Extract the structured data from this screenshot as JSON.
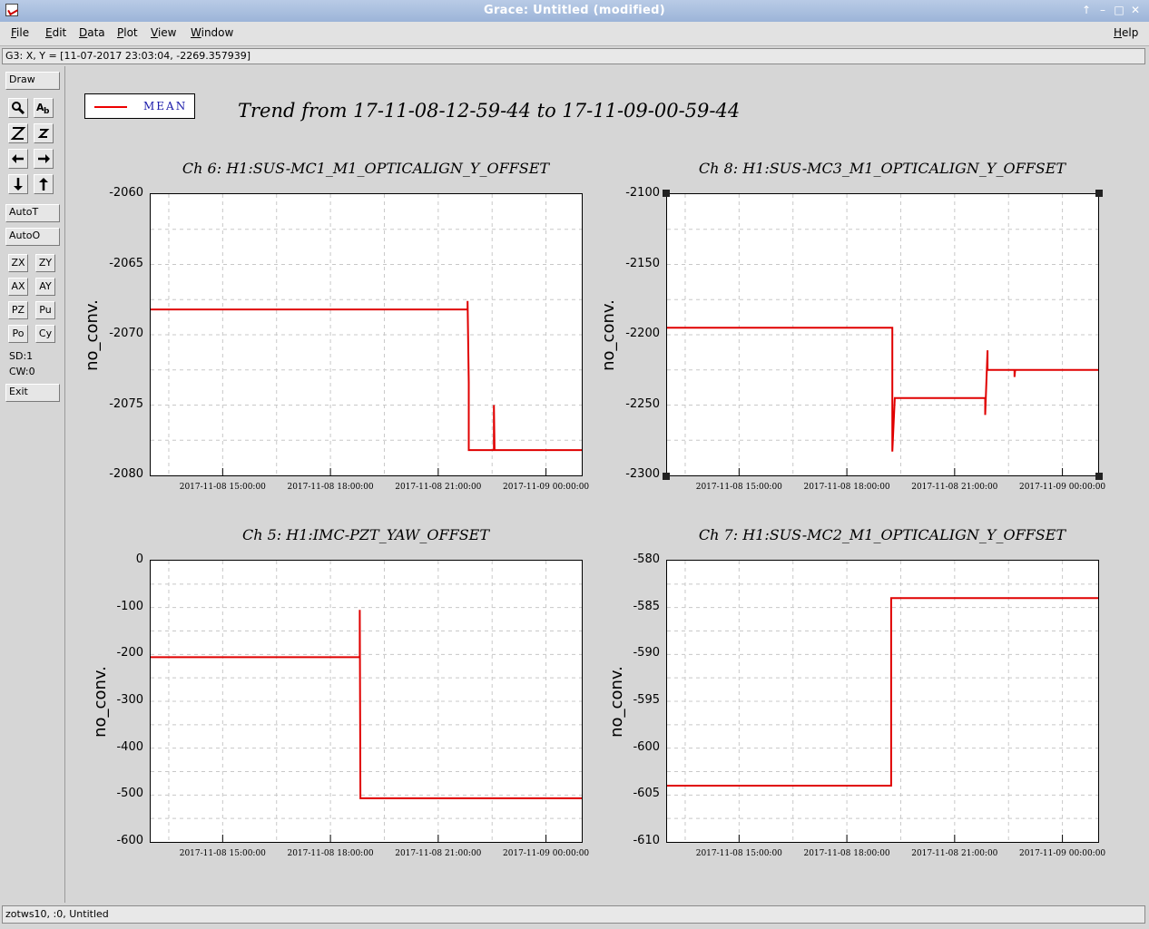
{
  "window": {
    "title": "Grace: Untitled (modified)"
  },
  "menu": {
    "file": "File",
    "edit": "Edit",
    "data": "Data",
    "plot": "Plot",
    "view": "View",
    "window": "Window",
    "help": "Help"
  },
  "coord_readout": "G3: X, Y = [11-07-2017 23:03:04, -2269.357939]",
  "toolbar": {
    "draw": "Draw",
    "autot": "AutoT",
    "autoo": "AutoO",
    "zx": "ZX",
    "zy": "ZY",
    "ax": "AX",
    "ay": "AY",
    "pz": "PZ",
    "pu": "Pu",
    "po": "Po",
    "cy": "Cy",
    "sd": "SD:1",
    "cw": "CW:0",
    "exit": "Exit",
    "icons": [
      "zoom-icon",
      "text-icon",
      "zoom-z-icon",
      "zoom-small-z-icon",
      "arrow-left-icon",
      "arrow-right-icon",
      "arrow-down-icon",
      "arrow-up-icon"
    ]
  },
  "legend": {
    "label": "MEAN",
    "color": "#e00000"
  },
  "main_title": "Trend from 17-11-08-12-59-44 to 17-11-09-00-59-44",
  "status": "zotws10, :0, Untitled",
  "chart_data": [
    {
      "type": "line",
      "title": "Ch 6: H1:SUS-MC1_M1_OPTICALIGN_Y_OFFSET",
      "ylabel": "no_conv.",
      "ylim": [
        -2080,
        -2060
      ],
      "yticks": [
        "-2060",
        "-2065",
        "-2070",
        "-2075",
        "-2080"
      ],
      "xticks": [
        "2017-11-08 15:00:00",
        "2017-11-08 18:00:00",
        "2017-11-08 21:00:00",
        "2017-11-09 00:00:00"
      ],
      "series": [
        {
          "name": "MEAN",
          "x": [
            "2017-11-08 12:59:44",
            "2017-11-08 21:49:00",
            "2017-11-08 21:49:00",
            "2017-11-08 21:51:00",
            "2017-11-08 21:51:00",
            "2017-11-08 22:33:00",
            "2017-11-08 22:33:00",
            "2017-11-08 22:34:00",
            "2017-11-08 22:34:00",
            "2017-11-09 00:59:44"
          ],
          "y": [
            -2068.2,
            -2068.2,
            -2067.6,
            -2073.4,
            -2078.2,
            -2078.2,
            -2075.0,
            -2078.2,
            -2078.2,
            -2078.2
          ]
        }
      ]
    },
    {
      "type": "line",
      "title": "Ch 8: H1:SUS-MC3_M1_OPTICALIGN_Y_OFFSET",
      "ylabel": "no_conv.",
      "ylim": [
        -2300,
        -2100
      ],
      "yticks": [
        "-2100",
        "-2150",
        "-2200",
        "-2250",
        "-2300"
      ],
      "xticks": [
        "2017-11-08 15:00:00",
        "2017-11-08 18:00:00",
        "2017-11-08 21:00:00",
        "2017-11-09 00:00:00"
      ],
      "series": [
        {
          "name": "MEAN",
          "x": [
            "2017-11-08 12:59:44",
            "2017-11-08 19:16:00",
            "2017-11-08 19:16:00",
            "2017-11-08 19:20:00",
            "2017-11-08 19:20:00",
            "2017-11-08 21:51:00",
            "2017-11-08 21:51:00",
            "2017-11-08 21:55:00",
            "2017-11-08 21:55:00",
            "2017-11-08 22:40:00",
            "2017-11-08 22:40:00",
            "2017-11-08 22:41:00",
            "2017-11-08 22:41:00",
            "2017-11-09 00:59:44"
          ],
          "y": [
            -2195,
            -2195,
            -2283,
            -2245,
            -2245,
            -2245,
            -2257,
            -2211,
            -2225,
            -2225,
            -2230,
            -2225,
            -2225,
            -2225
          ]
        }
      ]
    },
    {
      "type": "line",
      "title": "Ch 5: H1:IMC-PZT_YAW_OFFSET",
      "ylabel": "no_conv.",
      "ylim": [
        -600,
        0
      ],
      "yticks": [
        "0",
        "-100",
        "-200",
        "-300",
        "-400",
        "-500",
        "-600"
      ],
      "xticks": [
        "2017-11-08 15:00:00",
        "2017-11-08 18:00:00",
        "2017-11-08 21:00:00",
        "2017-11-09 00:00:00"
      ],
      "series": [
        {
          "name": "MEAN",
          "x": [
            "2017-11-08 12:59:44",
            "2017-11-08 18:49:00",
            "2017-11-08 18:49:00",
            "2017-11-08 18:50:00",
            "2017-11-08 18:50:00",
            "2017-11-09 00:59:44"
          ],
          "y": [
            -206,
            -206,
            -105,
            -500,
            -507,
            -507
          ]
        }
      ]
    },
    {
      "type": "line",
      "title": "Ch 7: H1:SUS-MC2_M1_OPTICALIGN_Y_OFFSET",
      "ylabel": "no_conv.",
      "ylim": [
        -610,
        -580
      ],
      "yticks": [
        "-580",
        "-585",
        "-590",
        "-595",
        "-600",
        "-605",
        "-610"
      ],
      "xticks": [
        "2017-11-08 15:00:00",
        "2017-11-08 18:00:00",
        "2017-11-08 21:00:00",
        "2017-11-09 00:00:00"
      ],
      "series": [
        {
          "name": "MEAN",
          "x": [
            "2017-11-08 12:59:44",
            "2017-11-08 19:14:00",
            "2017-11-08 19:14:00",
            "2017-11-09 00:59:44"
          ],
          "y": [
            -604,
            -604,
            -584,
            -584
          ]
        }
      ]
    }
  ]
}
